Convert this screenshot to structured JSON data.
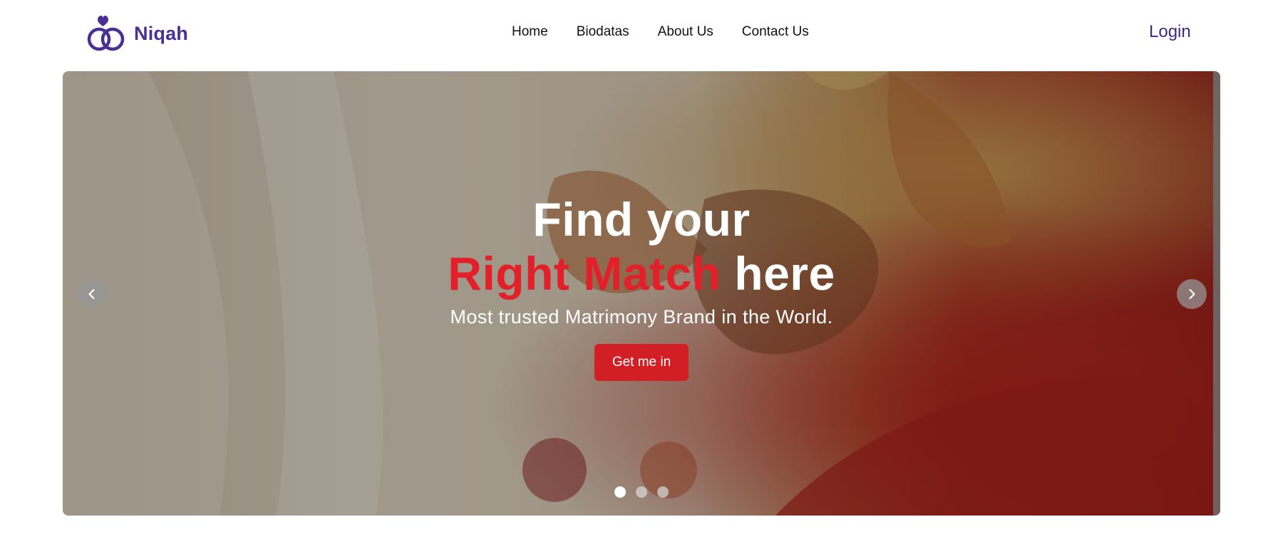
{
  "brand": {
    "name": "Niqah",
    "logo_icon": "rings-heart-icon",
    "color": "#4a2f94"
  },
  "nav": {
    "items": [
      {
        "label": "Home"
      },
      {
        "label": "Biodatas"
      },
      {
        "label": "About Us"
      },
      {
        "label": "Contact Us"
      }
    ],
    "login_label": "Login"
  },
  "hero": {
    "title_line1": "Find your",
    "title_accent": "Right Match",
    "title_rest": "here",
    "subtitle": "Most trusted Matrimony Brand in the World.",
    "cta_label": "Get me in",
    "accent_color": "#e3202a",
    "cta_color": "#d21f26",
    "prev_icon": "chevron-left-icon",
    "next_icon": "chevron-right-icon",
    "slide_count": 3,
    "active_slide": 1
  }
}
